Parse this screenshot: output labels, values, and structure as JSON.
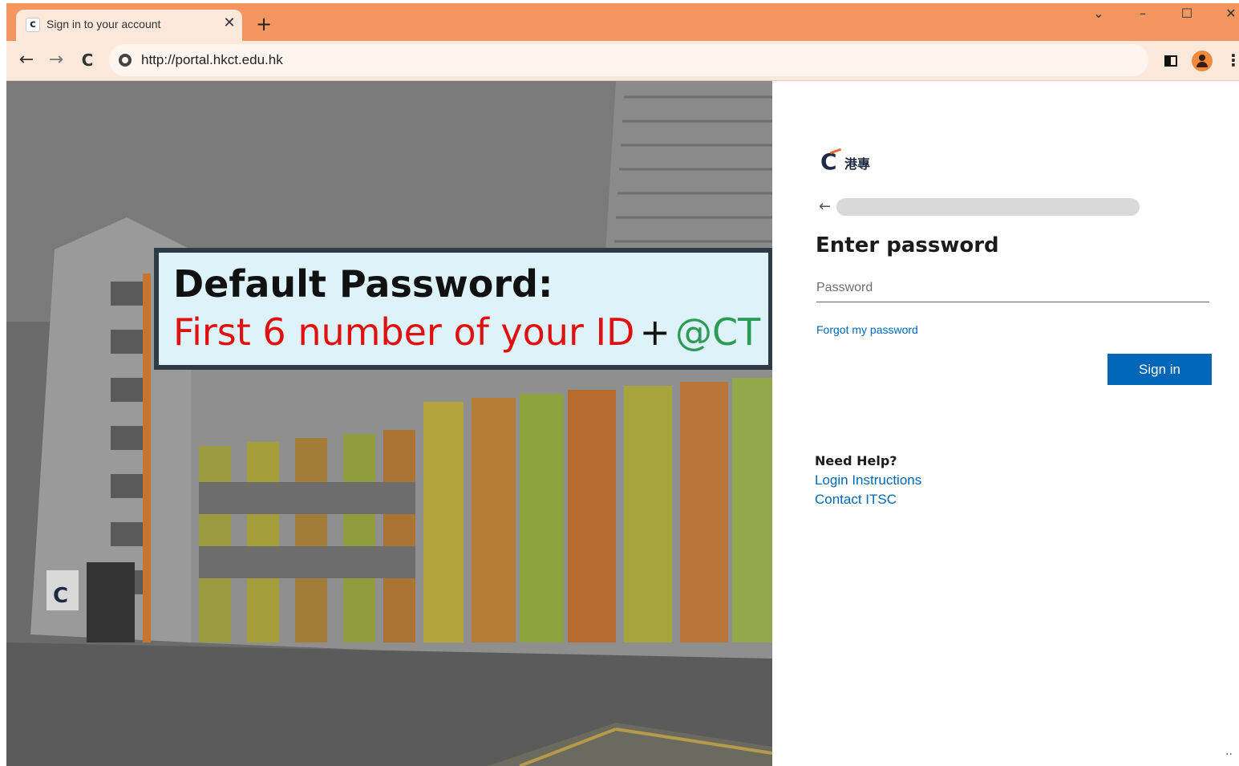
{
  "browser": {
    "tab_title": "Sign in to your account",
    "tab_favicon_letter": "c",
    "tab_close": "✕",
    "new_tab": "+",
    "url": "http://portal.hkct.edu.hk",
    "window_controls": {
      "chevron": "⌄",
      "minimize": "–",
      "maximize": "☐",
      "close": "✕"
    },
    "nav": {
      "back": "←",
      "forward": "→",
      "reload": "C"
    },
    "menu": "⋮",
    "accent_color": "#f5955f",
    "toolbar_color": "#fde8dc"
  },
  "callout": {
    "title": "Default Password:",
    "line_red": "First 6 number of your ID",
    "plus": "+",
    "line_green": "@CT"
  },
  "login": {
    "logo_letter": "C",
    "logo_text": "港專",
    "back_arrow": "←",
    "heading": "Enter password",
    "password_placeholder": "Password",
    "forgot_link": "Forgot my password",
    "signin_button": "Sign in",
    "help_title": "Need Help?",
    "help_links": [
      "Login Instructions",
      "Contact ITSC"
    ],
    "ellipsis": "..",
    "primary_color": "#0067b8"
  }
}
